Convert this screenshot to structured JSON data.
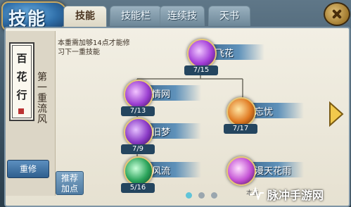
{
  "window": {
    "title": "技能",
    "tabs": [
      {
        "label": "技能",
        "active": true
      },
      {
        "label": "技能栏",
        "active": false
      },
      {
        "label": "连续技",
        "active": false
      },
      {
        "label": "天书",
        "active": false
      }
    ]
  },
  "sidebar": {
    "scroll_chars": [
      "百",
      "花",
      "行"
    ],
    "level_label": "第一重",
    "style_label": "流风",
    "retrain_label": "重修"
  },
  "hint": {
    "text": "本重需加够14点才能修习下一重技能"
  },
  "recommend": {
    "line1": "推荐",
    "line2": "加点"
  },
  "skills": [
    {
      "name": "飞花",
      "level": "7/15",
      "color": "#a43fd8"
    },
    {
      "name": "情网",
      "level": "7/13",
      "color": "#9b3fd1"
    },
    {
      "name": "忘忧",
      "level": "7/17",
      "color": "#e07a22"
    },
    {
      "name": "旧梦",
      "level": "7/9",
      "color": "#8a3ac6"
    },
    {
      "name": "风流",
      "level": "5/16",
      "color": "#2aa35a"
    },
    {
      "name": "漫天花雨",
      "level": "",
      "color": "#c34fd3"
    }
  ],
  "pager": {
    "total": 3,
    "active": 0
  },
  "footer": {
    "snippet": "本重"
  },
  "watermark": {
    "text": "脉冲手游网"
  }
}
